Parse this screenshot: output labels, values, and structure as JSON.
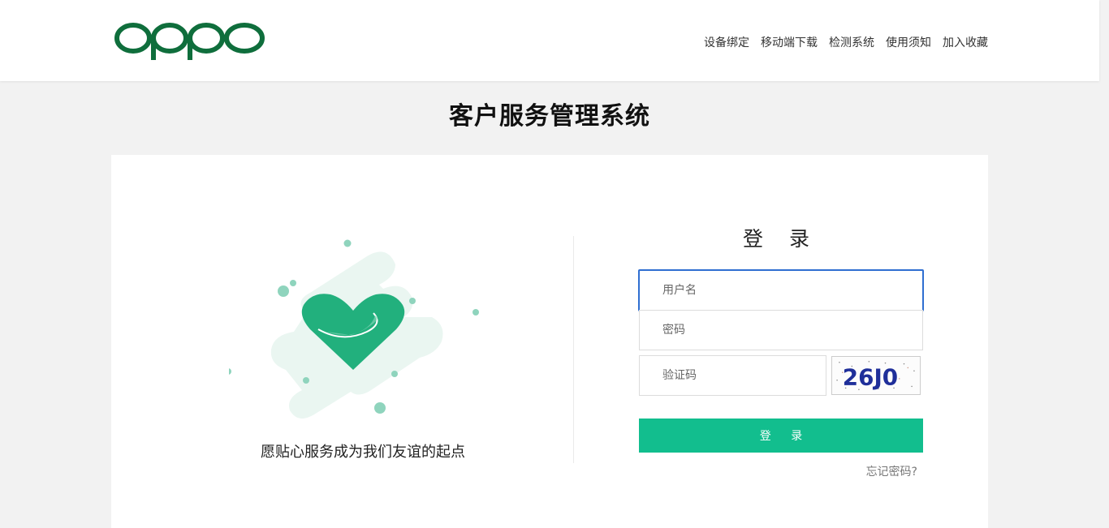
{
  "brand": {
    "logo_text": "oppo",
    "color": "#0f6e3c"
  },
  "nav": {
    "items": [
      {
        "label": "设备绑定"
      },
      {
        "label": "移动端下载"
      },
      {
        "label": "检测系统"
      },
      {
        "label": "使用须知"
      },
      {
        "label": "加入收藏"
      }
    ]
  },
  "page": {
    "title": "客户服务管理系统"
  },
  "illustration": {
    "slogan": "愿贴心服务成为我们友谊的起点",
    "accent": "#22b07d"
  },
  "login": {
    "title": "登 录",
    "username_placeholder": "用户名",
    "password_placeholder": "密码",
    "captcha_placeholder": "验证码",
    "captcha_text": "26J0",
    "submit_label": "登 录",
    "forgot_label": "忘记密码?",
    "button_color": "#12be8e",
    "focus_color": "#2f6fd1"
  }
}
